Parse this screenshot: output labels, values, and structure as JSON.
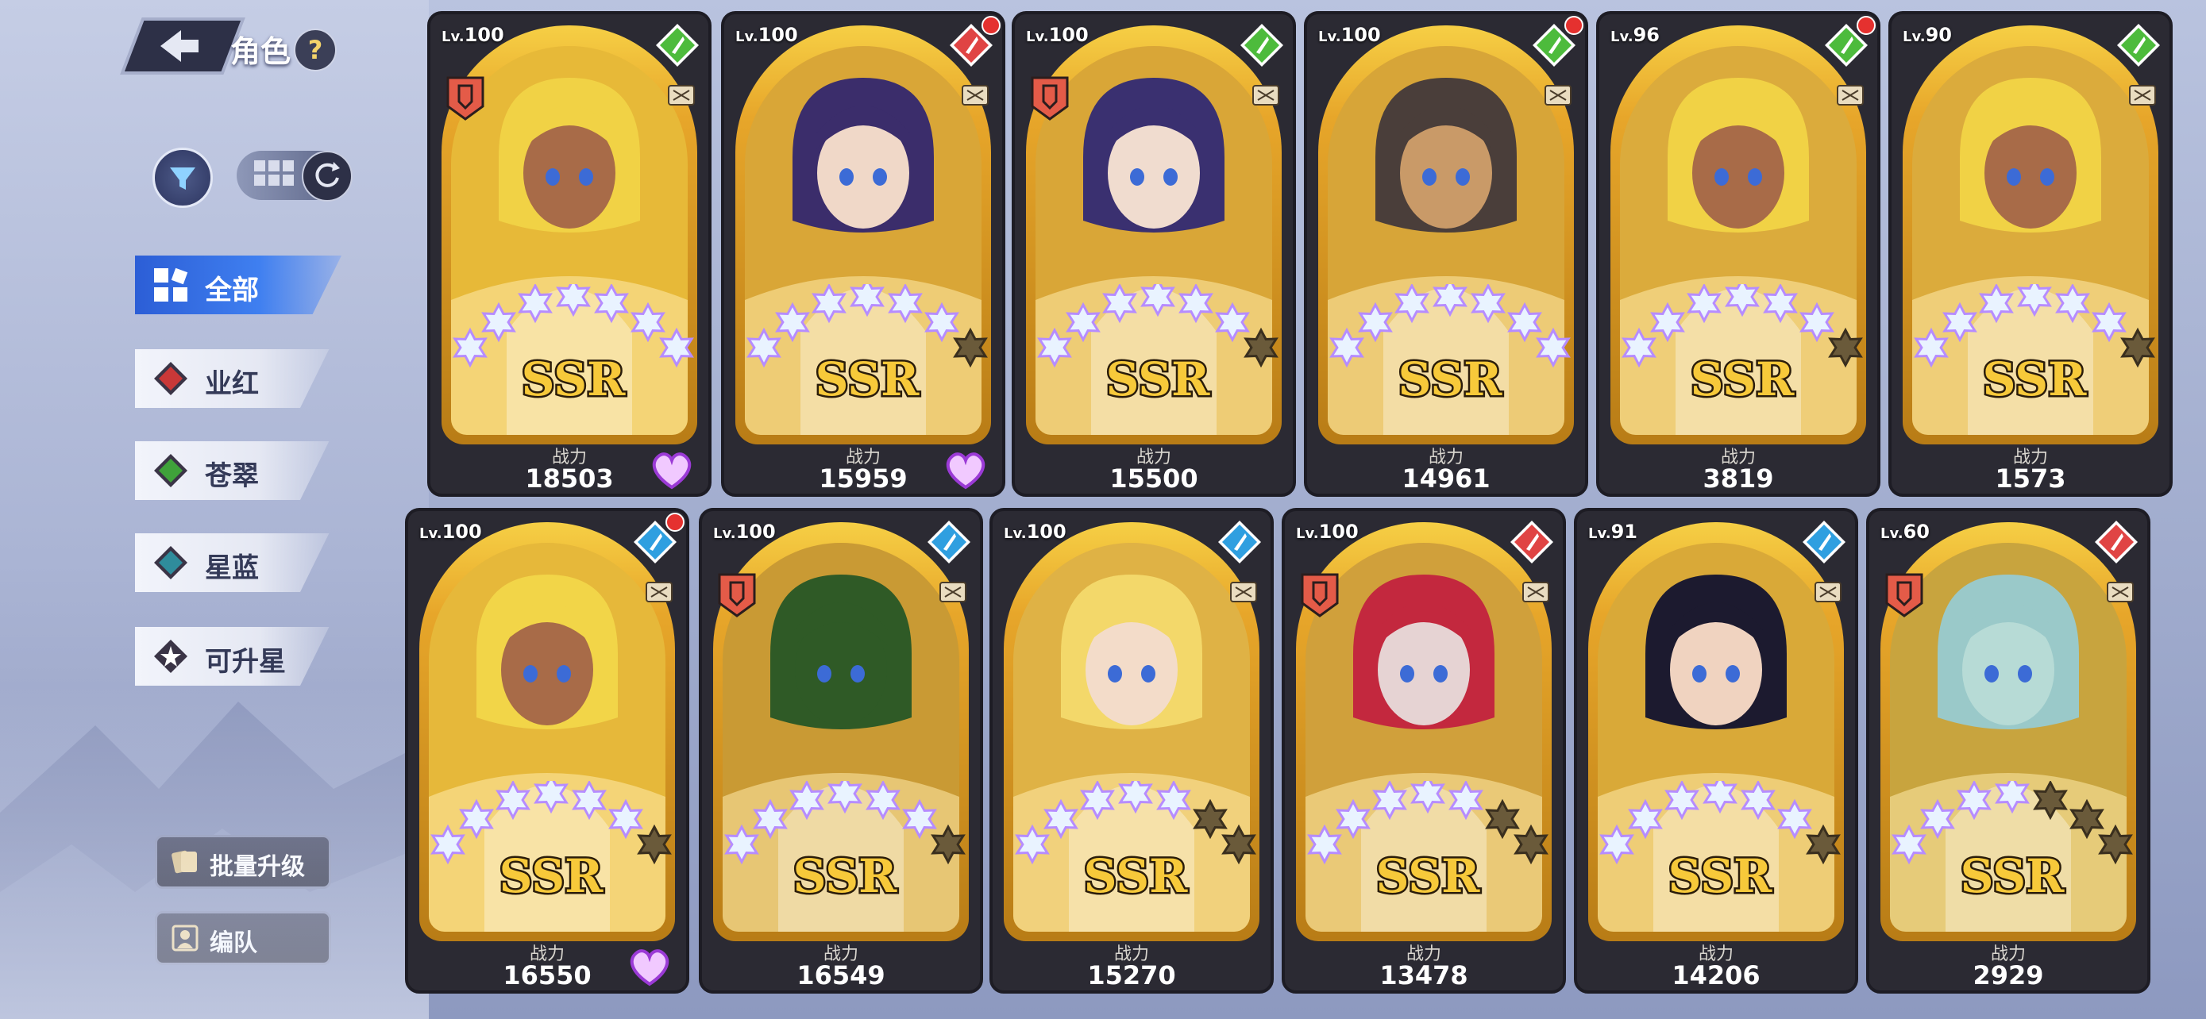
{
  "header": {
    "title": "角色",
    "help_label": "?"
  },
  "filters": {
    "tabs": [
      {
        "label": "全部",
        "icon": "grid-icon",
        "selected": true
      },
      {
        "label": "业红",
        "icon": "red-gem-icon"
      },
      {
        "label": "苍翠",
        "icon": "green-gem-icon"
      },
      {
        "label": "星蓝",
        "icon": "blue-gem-icon"
      },
      {
        "label": "可升星",
        "icon": "star-up-icon"
      }
    ]
  },
  "actions": {
    "batch_upgrade": "批量升级",
    "formation": "编队"
  },
  "power_label": "战力",
  "rarity_label": "SSR",
  "lv_prefix": "Lv.",
  "cards": [
    {
      "level": "100",
      "power": "18503",
      "element": "green",
      "faction": true,
      "dot": false,
      "heart": true,
      "stars": 6,
      "hair": "#f1d245",
      "skin": "#a86b48",
      "bg": "#e7b938"
    },
    {
      "level": "100",
      "power": "15959",
      "element": "red",
      "faction": false,
      "dot": true,
      "heart": true,
      "stars": 5,
      "hair": "#3b2d6b",
      "skin": "#f0d8c8",
      "bg": "#d9a637"
    },
    {
      "level": "100",
      "power": "15500",
      "element": "green",
      "faction": true,
      "dot": false,
      "heart": false,
      "stars": 5,
      "hair": "#3a3070",
      "skin": "#f0dccf",
      "bg": "#d9a637"
    },
    {
      "level": "100",
      "power": "14961",
      "element": "green",
      "faction": false,
      "dot": true,
      "heart": false,
      "stars": 6,
      "hair": "#4a3e3a",
      "skin": "#c99a68",
      "bg": "#d7a538"
    },
    {
      "level": "96",
      "power": "3819",
      "element": "green",
      "faction": false,
      "dot": true,
      "heart": false,
      "stars": 5,
      "hair": "#f1d245",
      "skin": "#a86b48",
      "bg": "#dbab3c"
    },
    {
      "level": "90",
      "power": "1573",
      "element": "green",
      "faction": false,
      "dot": false,
      "heart": false,
      "stars": 5,
      "hair": "#f1d245",
      "skin": "#a86b48",
      "bg": "#dbab3c"
    },
    {
      "level": "100",
      "power": "16550",
      "element": "blue",
      "faction": false,
      "dot": true,
      "heart": true,
      "stars": 5,
      "hair": "#f2d548",
      "skin": "#a86b48",
      "bg": "#e6b83a"
    },
    {
      "level": "100",
      "power": "16549",
      "element": "blue",
      "faction": true,
      "dot": false,
      "heart": false,
      "stars": 5,
      "hair": "#2f5a26",
      "skin": "#2f5a26",
      "bg": "#c99a34"
    },
    {
      "level": "100",
      "power": "15270",
      "element": "blue",
      "faction": false,
      "dot": false,
      "heart": false,
      "stars": 4,
      "hair": "#f3d86a",
      "skin": "#f3dcc9",
      "bg": "#dfb245"
    },
    {
      "level": "100",
      "power": "13478",
      "element": "red",
      "faction": true,
      "dot": false,
      "heart": false,
      "stars": 4,
      "hair": "#c3283e",
      "skin": "#e6d3d3",
      "bg": "#d0a03b"
    },
    {
      "level": "91",
      "power": "14206",
      "element": "blue",
      "faction": false,
      "dot": false,
      "heart": false,
      "stars": 5,
      "hair": "#1c1a2f",
      "skin": "#f0d3c0",
      "bg": "#d9a938"
    },
    {
      "level": "60",
      "power": "2929",
      "element": "red",
      "faction": true,
      "dot": false,
      "heart": false,
      "stars": 3,
      "hair": "#9ac9c9",
      "skin": "#b7dbd6",
      "bg": "#c8a43e"
    }
  ],
  "colors": {
    "accent": "#3f7ff0",
    "red": "#e04444",
    "green": "#4dbb3c",
    "blue": "#2f9fe0",
    "gold": "#f3c235"
  }
}
